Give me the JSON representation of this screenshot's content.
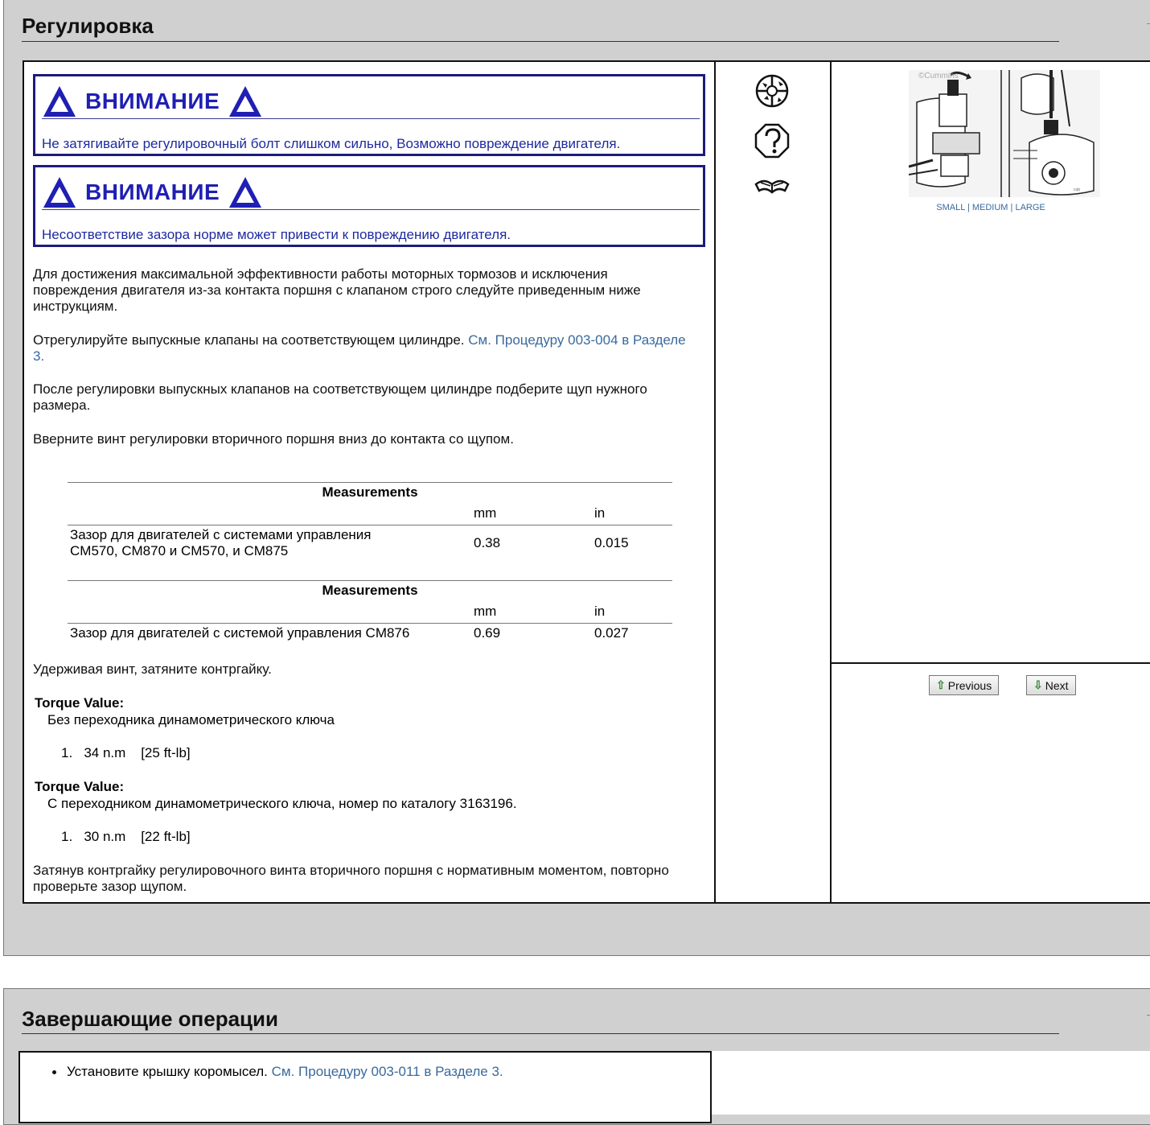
{
  "section1": {
    "title": "Регулировка",
    "warnings": [
      {
        "heading": "ВНИМАНИЕ",
        "text": "Не затягивайте регулировочный болт слишком сильно, Возможно повреждение двигателя."
      },
      {
        "heading": "ВНИМАНИЕ",
        "text": "Несоответствие зазора норме может привести к повреждению двигателя."
      }
    ],
    "para1_line1": "Для достижения максимальной эффективности работы моторных тормозов и исключения",
    "para1_line2": "повреждения двигателя из-за контакта поршня с клапаном строго следуйте приведенным ниже",
    "para1_line3": "инструкциям.",
    "para2_text": "Отрегулируйте выпускные клапаны на соответствующем цилиндре. ",
    "para2_link_line1": "См. Процедуру 003-004 в Разделе",
    "para2_link_line2": "3.",
    "para3_line1": "После регулировки выпускных клапанов на соответствующем цилиндре подберите щуп нужного",
    "para3_line2": "размера.",
    "para4": "Вверните винт регулировки вторичного поршня вниз до контакта со щупом.",
    "measurements": [
      {
        "caption": "Measurements",
        "unit_mm": "mm",
        "unit_in": "in",
        "label_line1": "Зазор для двигателей с системами управления",
        "label_line2": "CM570, CM870 и CM570, и CM875",
        "mm": "0.38",
        "in": "0.015"
      },
      {
        "caption": "Measurements",
        "unit_mm": "mm",
        "unit_in": "in",
        "label_line1": "Зазор для двигателей с системой управления CM876",
        "mm": "0.69",
        "in": "0.027"
      }
    ],
    "para5": "Удерживая винт, затяните контргайку.",
    "torque": [
      {
        "heading": "Torque Value:",
        "desc": "Без переходника динамометрического ключа",
        "item": "1.   34 n.m    [25 ft-lb]"
      },
      {
        "heading": "Torque Value:",
        "desc": "С переходником динамометрического ключа, номер по каталогу 3163196.",
        "item": "1.   30 n.m    [22 ft-lb]"
      }
    ],
    "para6_line1": "Затянув контргайку регулировочного винта вторичного поршня с нормативным моментом, повторно",
    "para6_line2": "проверьте зазор щупом.",
    "icons": [
      "tools-icon",
      "help-icon",
      "shop-manual-icon"
    ],
    "image": {
      "watermark": "©Cummins",
      "sizes": "SMALL | MEDIUM | LARGE"
    },
    "nav": {
      "previous": "Previous",
      "next": "Next"
    }
  },
  "section2": {
    "title": "Завершающие операции",
    "bullet_text": "Установите крышку коромысел. ",
    "bullet_link": "См. Процедуру 003-011 в Разделе 3."
  },
  "colors": {
    "warning_border": "#1c1c7c",
    "warning_text": "#1f1fb4",
    "link": "#3a6a9c",
    "panel_bg": "#d0d0d0"
  }
}
